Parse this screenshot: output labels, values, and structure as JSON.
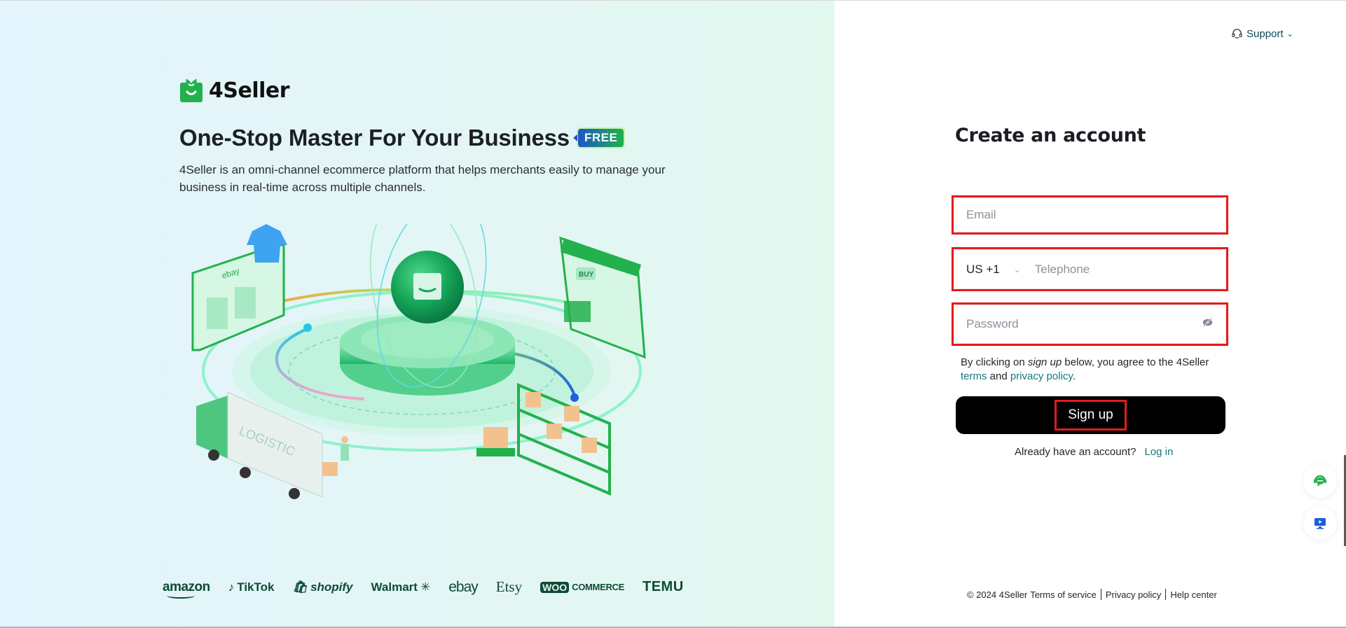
{
  "brand": {
    "name": "4Seller",
    "logo_icon": "shopping-bag-smile-icon",
    "accent_color": "#22b14c"
  },
  "hero": {
    "headline": "One-Stop Master For Your Business",
    "badge": "FREE",
    "description": "4Seller is an omni-channel ecommerce platform that helps merchants easily to manage your business in real-time across multiple channels.",
    "illustration_labels": {
      "marketplace_logo": "ebay",
      "shop_sign": "BUY",
      "truck_label": "LOGISTIC"
    }
  },
  "channels": [
    "amazon",
    "TikTok",
    "shopify",
    "Walmart",
    "ebay",
    "Etsy",
    "WOO COMMERCE",
    "TEMU"
  ],
  "header": {
    "support_label": "Support",
    "support_icon": "headset-icon"
  },
  "form": {
    "title": "Create an account",
    "email": {
      "placeholder": "Email",
      "value": ""
    },
    "phone": {
      "country_code": "US +1",
      "placeholder": "Telephone",
      "value": ""
    },
    "password": {
      "placeholder": "Password",
      "value": "",
      "toggle_icon": "eye-off-icon"
    },
    "agreement": {
      "prefix": "By clicking on ",
      "emphasis": "sign up",
      "middle": " below, you agree to the 4Seller ",
      "terms_link": "terms",
      "and": " and ",
      "privacy_link": "privacy policy",
      "suffix": "."
    },
    "submit_label": "Sign up",
    "login_prompt": "Already have an account?",
    "login_link": "Log in",
    "highlight_color": "#e51b1b"
  },
  "footer": {
    "copyright": "© 2024 4Seller",
    "links": [
      "Terms of service",
      "Privacy policy",
      "Help center"
    ]
  },
  "floating": [
    {
      "name": "live-chat",
      "icon": "chat-headset-icon",
      "color": "#22b14c"
    },
    {
      "name": "video-tutorial",
      "icon": "monitor-play-icon",
      "color": "#1e5fd8"
    }
  ]
}
